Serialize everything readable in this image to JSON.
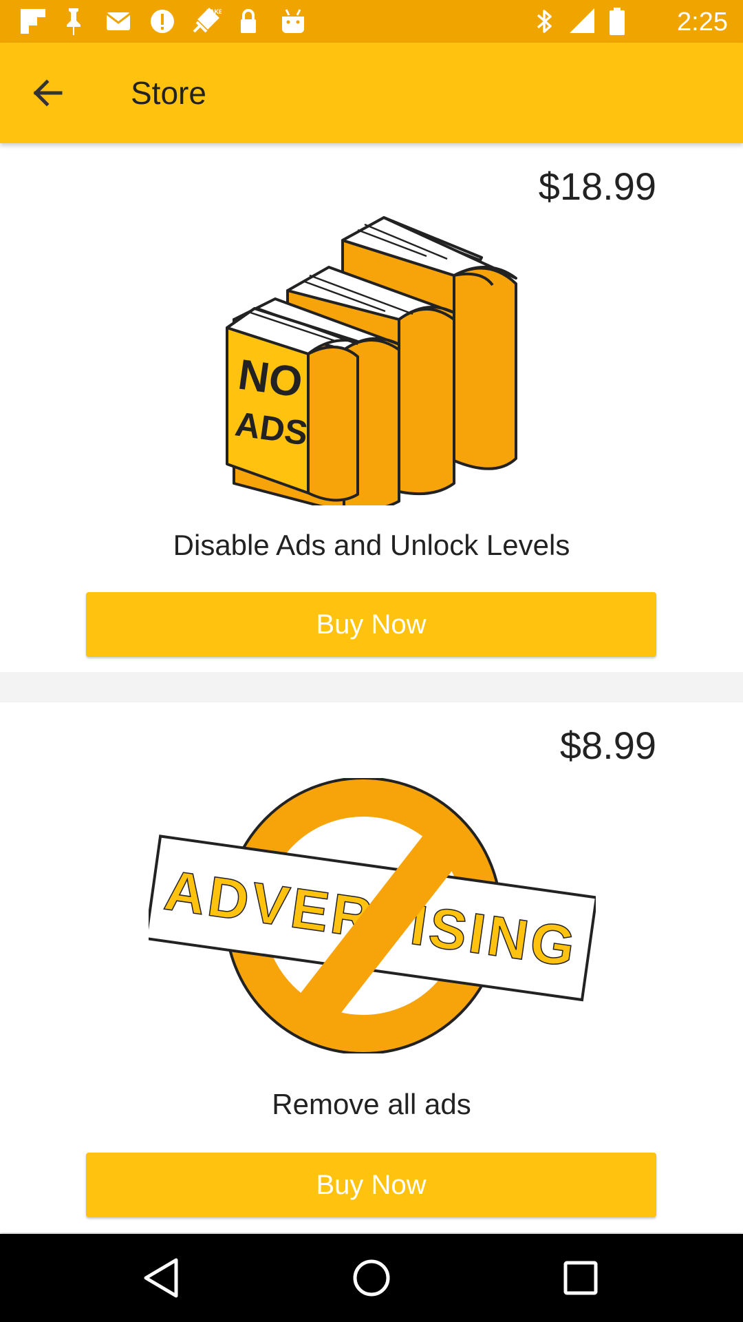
{
  "status_bar": {
    "time": "2:25",
    "left_icons": [
      "flipboard-icon",
      "pin-icon",
      "message-icon",
      "data-saver-icon",
      "fake-gps-icon",
      "lock-icon",
      "android-icon"
    ],
    "right_icons": [
      "bluetooth-icon",
      "signal-icon",
      "battery-icon"
    ]
  },
  "app_bar": {
    "title": "Store",
    "back_icon": "arrow-back-icon"
  },
  "products": [
    {
      "price": "$18.99",
      "image_icon": "no-ads-books-icon",
      "image_text_line1": "NO",
      "image_text_line2": "ADS",
      "description": "Disable Ads and Unlock Levels",
      "button_label": "Buy Now"
    },
    {
      "price": "$8.99",
      "image_icon": "no-advertising-icon",
      "image_text": "ADVERTISING",
      "description": "Remove all ads",
      "button_label": "Buy Now"
    }
  ],
  "nav_bar": {
    "back_icon": "nav-back-icon",
    "home_icon": "nav-home-icon",
    "recents_icon": "nav-recents-icon"
  },
  "colors": {
    "status_bar": "#f0a400",
    "app_bar": "#ffc20e",
    "accent_orange": "#f7a30a",
    "button": "#ffc20e",
    "nav_bar": "#000000"
  }
}
